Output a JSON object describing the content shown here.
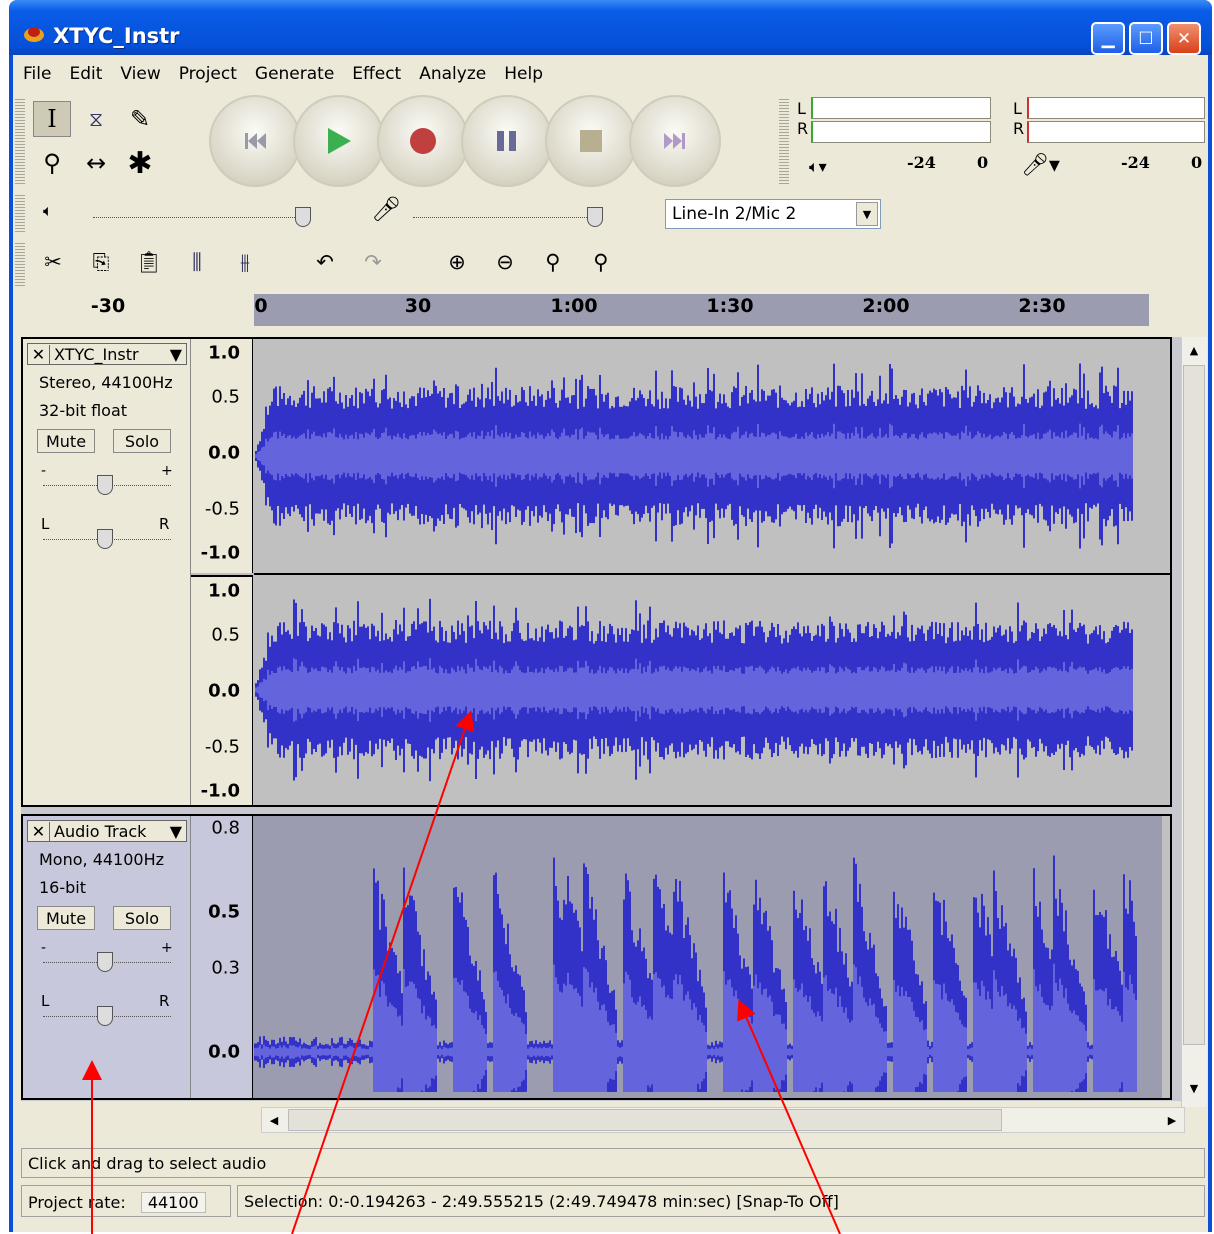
{
  "window": {
    "title": "XTYC_Instr"
  },
  "menu": [
    "File",
    "Edit",
    "View",
    "Project",
    "Generate",
    "Effect",
    "Analyze",
    "Help"
  ],
  "meters": {
    "playback": {
      "l": "L",
      "r": "R",
      "mid": "-24",
      "end": "0"
    },
    "record": {
      "l": "L",
      "r": "R",
      "mid": "-24",
      "end": "0"
    }
  },
  "input_source": {
    "selected": "Line-In 2/Mic 2"
  },
  "ruler": {
    "ticks": [
      "-30",
      "0",
      "30",
      "1:00",
      "1:30",
      "2:00",
      "2:30"
    ]
  },
  "tracks": [
    {
      "name": "XTYC_Instr",
      "format": "Stereo, 44100Hz",
      "bitdepth": "32-bit float",
      "mute": "Mute",
      "solo": "Solo",
      "gain_minus": "-",
      "gain_plus": "+",
      "pan_left": "L",
      "pan_right": "R",
      "scale": [
        "1.0",
        "0.5",
        "0.0",
        "-0.5",
        "-1.0"
      ]
    },
    {
      "name": "Audio Track",
      "format": "Mono, 44100Hz",
      "bitdepth": "16-bit",
      "mute": "Mute",
      "solo": "Solo",
      "gain_minus": "-",
      "gain_plus": "+",
      "pan_left": "L",
      "pan_right": "R",
      "scale": [
        "0.8",
        "0.5",
        "0.3",
        "0.0"
      ]
    }
  ],
  "status": {
    "message": "Click and drag to select audio",
    "project_rate_label": "Project rate:",
    "project_rate": "44100",
    "selection": "Selection: 0:-0.194263 - 2:49.555215 (2:49.749478 min:sec)  [Snap-To Off]"
  },
  "colors": {
    "waveform": "#3232c8",
    "waveform_rms": "#6464dc",
    "title_bar": "#0a5ce8",
    "annotation": "#ff0000"
  }
}
